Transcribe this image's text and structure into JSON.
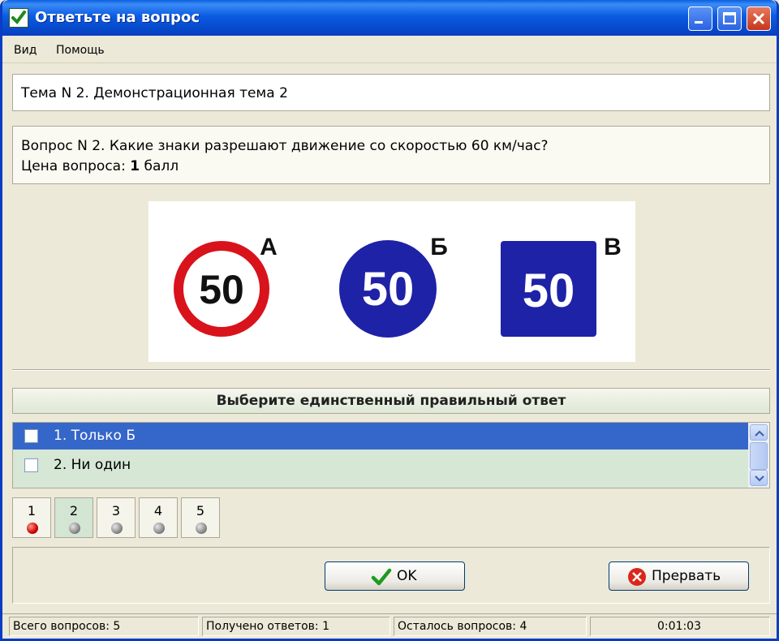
{
  "window": {
    "title": "Ответьте на вопрос"
  },
  "menu": {
    "items": [
      "Вид",
      "Помощь"
    ]
  },
  "topic": {
    "text": "Тема N 2. Демонстрационная тема 2"
  },
  "question": {
    "text": "Вопрос N 2. Какие знаки разрешают движение со скоростью 60 км/час?",
    "price_label": "Цена вопроса:",
    "price_value": "1",
    "price_unit": "балл"
  },
  "signs": [
    {
      "letter": "А",
      "value": "50",
      "type": "prohibitory",
      "color": "#d8131b"
    },
    {
      "letter": "Б",
      "value": "50",
      "type": "mandatory",
      "color": "#1e22a6"
    },
    {
      "letter": "В",
      "value": "50",
      "type": "informational",
      "color": "#1e22a6"
    }
  ],
  "instruction": "Выберите единственный правильный ответ",
  "answers": [
    {
      "label": "1. Только Б",
      "selected": true,
      "checked": false
    },
    {
      "label": "2. Ни один",
      "selected": false,
      "checked": false
    }
  ],
  "question_nav": [
    {
      "num": "1",
      "status": "answered",
      "current": false
    },
    {
      "num": "2",
      "status": "unanswered",
      "current": true
    },
    {
      "num": "3",
      "status": "unanswered",
      "current": false
    },
    {
      "num": "4",
      "status": "unanswered",
      "current": false
    },
    {
      "num": "5",
      "status": "unanswered",
      "current": false
    }
  ],
  "buttons": {
    "ok": "OK",
    "abort": "Прервать"
  },
  "status": {
    "total": "Всего вопросов: 5",
    "answered": "Получено ответов: 1",
    "remaining": "Осталось вопросов: 4",
    "timer": "0:01:03"
  },
  "colors": {
    "title_bar": "#0a5fe0",
    "selection": "#3566c9",
    "answer_bg": "#d6e7d6"
  }
}
